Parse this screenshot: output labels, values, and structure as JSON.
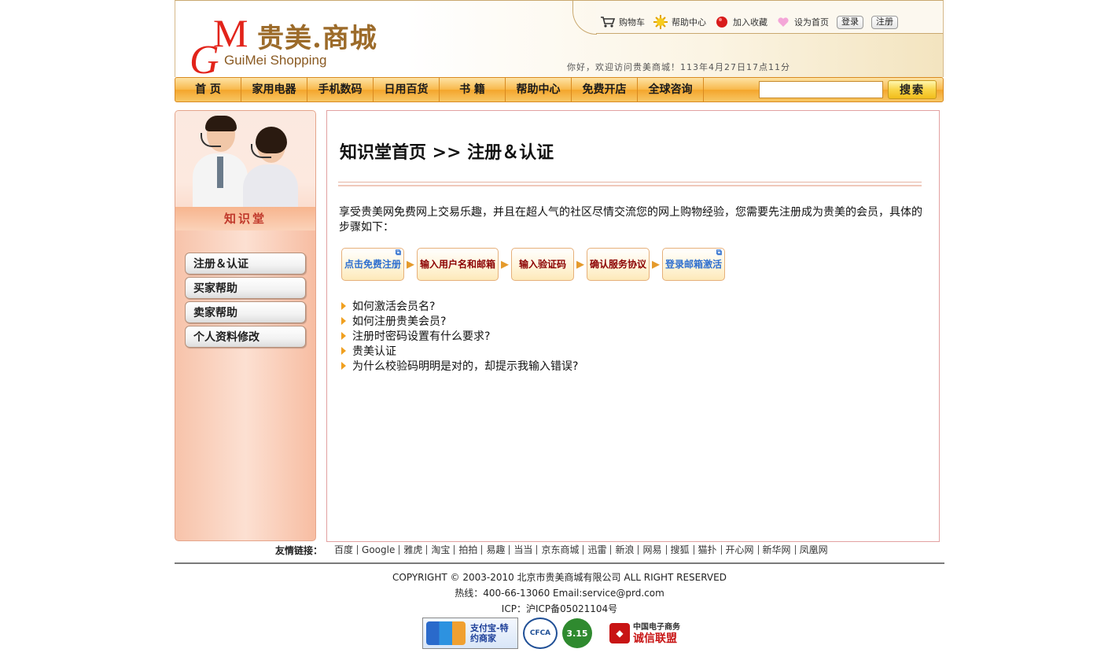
{
  "header": {
    "logo_cn": "贵美.商城",
    "logo_en": "GuiMei Shopping",
    "logo_g": "G",
    "logo_m": "M",
    "top_links": [
      {
        "label": "购物车",
        "icon": "cart-icon"
      },
      {
        "label": "帮助中心",
        "icon": "sun-icon"
      },
      {
        "label": "加入收藏",
        "icon": "red-ball-icon"
      },
      {
        "label": "设为首页",
        "icon": "pink-heart-icon"
      }
    ],
    "login_label": "登录",
    "register_label": "注册",
    "welcome": "你好，欢迎访问贵美商城！113年4月27日17点11分"
  },
  "nav": {
    "items": [
      "首 页",
      "家用电器",
      "手机数码",
      "日用百货",
      "书 籍",
      "帮助中心",
      "免费开店",
      "全球咨询"
    ],
    "search_placeholder": "",
    "search_button": "搜索"
  },
  "sidebar": {
    "banner_title": "知识堂",
    "menu": [
      "注册＆认证",
      "买家帮助",
      "卖家帮助",
      "个人资料修改"
    ]
  },
  "main": {
    "title": "知识堂首页 >> 注册＆认证",
    "intro": "享受贵美网免费网上交易乐趣，并且在超人气的社区尽情交流您的网上购物经验，您需要先注册成为贵美的会员，具体的步骤如下：",
    "steps": [
      {
        "label": "点击免费注册",
        "kind": "link"
      },
      {
        "label": "输入用户名和邮箱",
        "kind": "plain"
      },
      {
        "label": "输入验证码",
        "kind": "plain"
      },
      {
        "label": "确认服务协议",
        "kind": "plain"
      },
      {
        "label": "登录邮箱激活",
        "kind": "link"
      }
    ],
    "faq": [
      "如何激活会员名?",
      "如何注册贵美会员?",
      "注册时密码设置有什么要求?",
      "贵美认证",
      "为什么校验码明明是对的，却提示我输入错误?"
    ]
  },
  "footer": {
    "friend_label": "友情链接：",
    "friend_links": [
      "百度",
      "Google",
      "雅虎",
      "淘宝",
      "拍拍",
      "易趣",
      "当当",
      "京东商城",
      "迅雷",
      "新浪",
      "网易",
      "搜狐",
      "猫扑",
      "开心网",
      "新华网",
      "凤凰网"
    ],
    "copyright": "COPYRIGHT © 2003-2010 北京市贵美商城有限公司 ALL RIGHT RESERVED",
    "hotline": "热线：400-66-13060 Email:service@prd.com",
    "icp": "ICP：沪ICP备05021104号",
    "badges": {
      "alipay": "支付宝-特约商家",
      "cfca": "CFCA",
      "c315": "3.15",
      "cx_line1": "中国电子商务",
      "cx_line2": "诚信联盟"
    }
  },
  "colors": {
    "brand_red": "#e2231a",
    "nav_orange": "#f4a52b",
    "link_blue": "#2e6fcf",
    "dark_red": "#8b0000"
  }
}
